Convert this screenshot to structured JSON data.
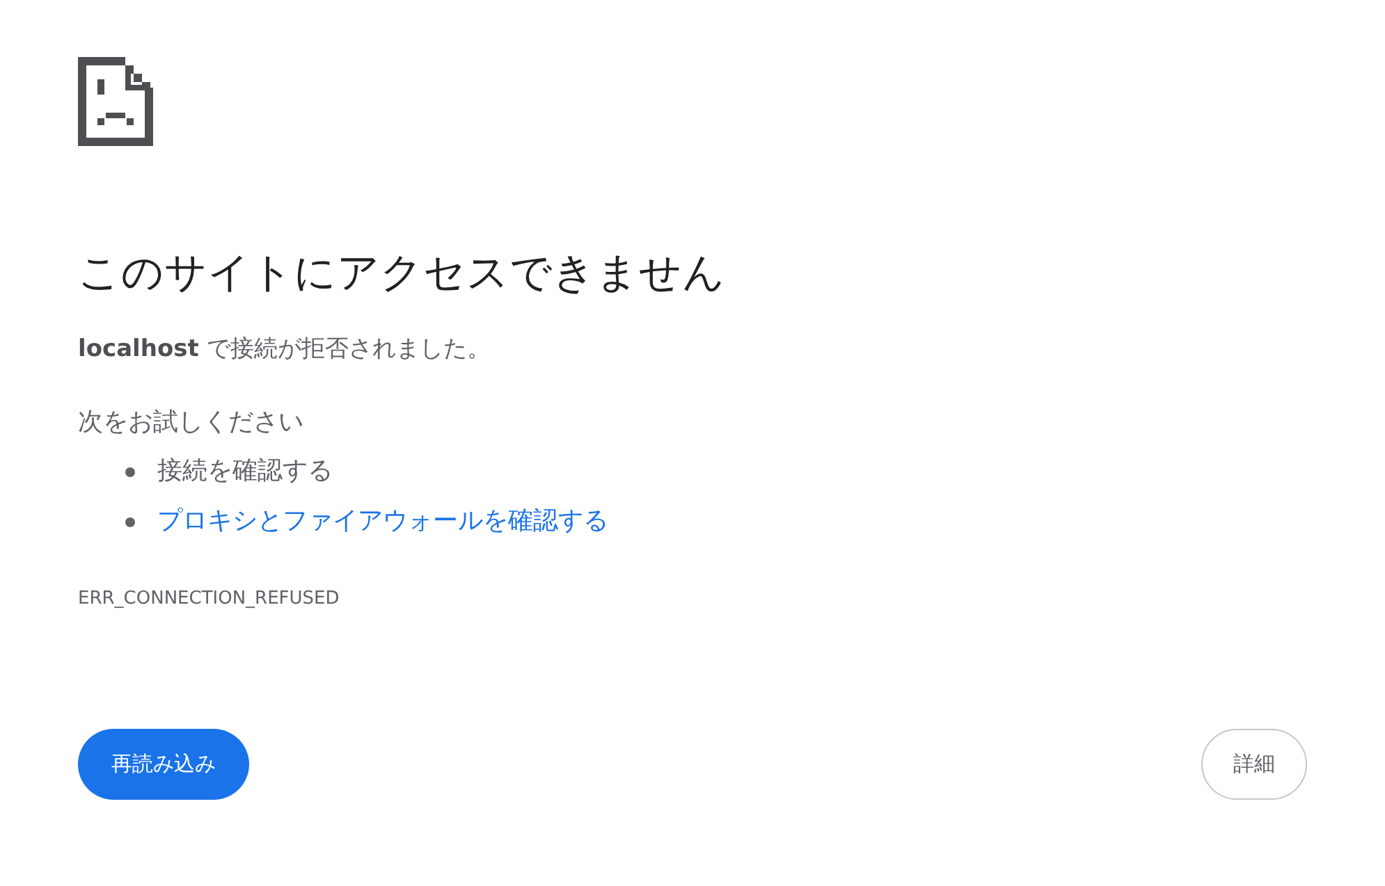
{
  "heading": "このサイトにアクセスできません",
  "message": "**localhost** で接続が拒否されました。",
  "suggestions_title": "次をお試しください",
  "suggestions": [
    {
      "kind": "text",
      "label": "接続を確認する"
    },
    {
      "kind": "link",
      "label": "プロキシとファイアウォールを確認する"
    }
  ],
  "error_code": "ERR_CONNECTION_REFUSED",
  "buttons": [
    {
      "kind": "primary",
      "label": "再読み込み"
    },
    {
      "kind": "secondary",
      "label": "詳細"
    }
  ]
}
